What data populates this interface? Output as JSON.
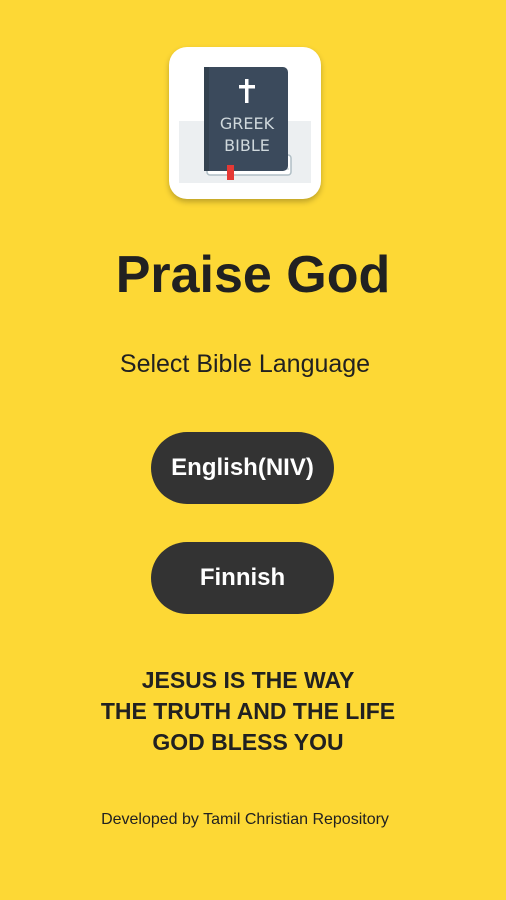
{
  "app_icon": {
    "icon": "greek-bible-book-icon",
    "book_line1": "GREEK",
    "book_line2": "BIBLE",
    "cross": "✝"
  },
  "title": "Praise God",
  "subtitle": "Select Bible Language",
  "language_buttons": [
    {
      "label": "English(NIV)"
    },
    {
      "label": "Finnish"
    }
  ],
  "message": {
    "line1": "JESUS IS THE WAY",
    "line2": "THE TRUTH AND THE LIFE",
    "line3": "GOD BLESS YOU"
  },
  "footer": "Developed by Tamil Christian Repository",
  "colors": {
    "background": "#FDD835",
    "button": "#333333",
    "button_text": "#FFFFFF",
    "text": "#212121",
    "book_cover": "#3B4A5C",
    "bookmark": "#E53935"
  }
}
